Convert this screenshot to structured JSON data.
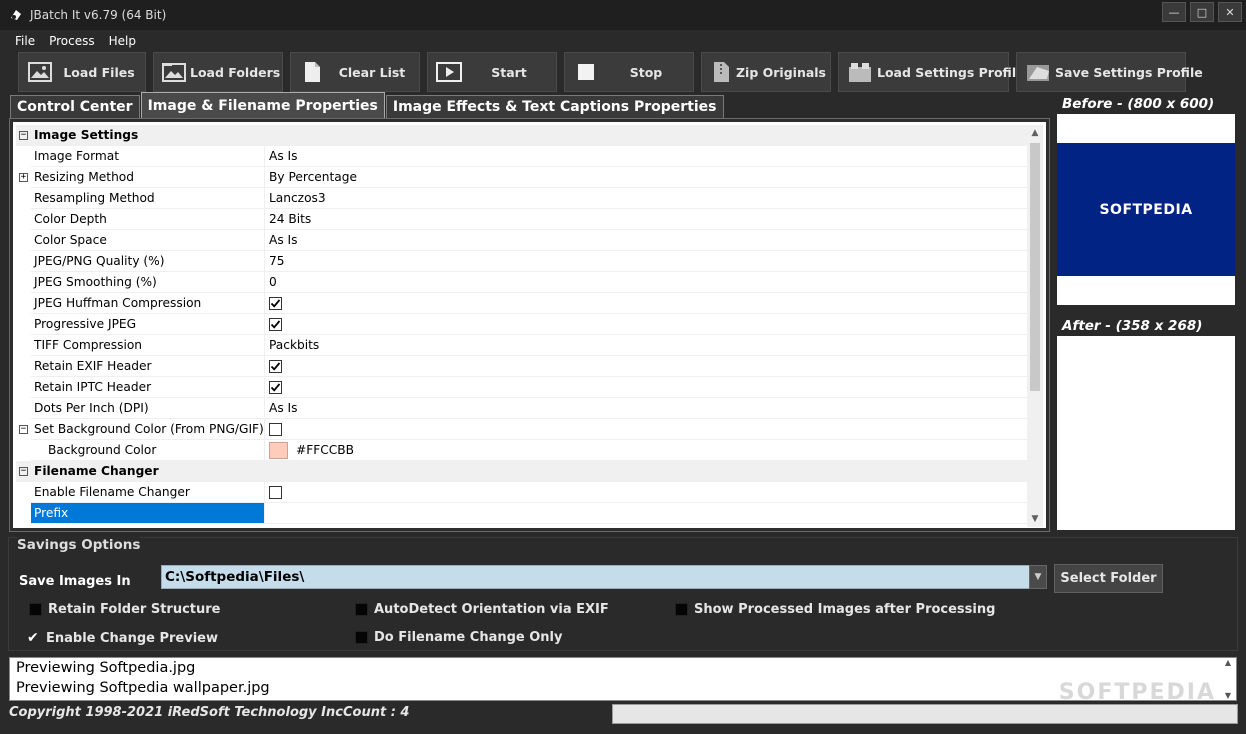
{
  "window": {
    "title": "JBatch It v6.79 (64 Bit)",
    "controls": [
      "—",
      "□",
      "✕"
    ]
  },
  "menu": [
    "File",
    "Process",
    "Help"
  ],
  "toolbar": [
    {
      "label": "Load Files",
      "icon": "image-icon",
      "width": 128
    },
    {
      "label": "Load Folders",
      "icon": "folder-image-icon",
      "width": 130
    },
    {
      "label": "Clear List",
      "icon": "document-icon",
      "width": 130
    },
    {
      "label": "Start",
      "icon": "play-icon",
      "width": 130
    },
    {
      "label": "Stop",
      "icon": "stop-icon",
      "width": 130
    },
    {
      "label": "Zip Originals",
      "icon": "zip-icon",
      "width": 130
    },
    {
      "label": "Load Settings Profile",
      "icon": "load-profile-icon",
      "width": 171
    },
    {
      "label": "Save Settings Profile",
      "icon": "save-profile-icon",
      "width": 170
    }
  ],
  "tabs": [
    {
      "label": "Control Center",
      "active": false
    },
    {
      "label": "Image & Filename Properties",
      "active": true
    },
    {
      "label": "Image Effects & Text Captions Properties",
      "active": false
    }
  ],
  "properties": [
    {
      "type": "category",
      "name": "Image Settings",
      "expander": "−"
    },
    {
      "name": "Image Format",
      "value": "As Is"
    },
    {
      "name": "Resizing Method",
      "value": "By Percentage",
      "expander": "+"
    },
    {
      "name": "Resampling Method",
      "value": "Lanczos3"
    },
    {
      "name": "Color Depth",
      "value": "24 Bits"
    },
    {
      "name": "Color Space",
      "value": "As Is"
    },
    {
      "name": "JPEG/PNG Quality (%)",
      "value": "75"
    },
    {
      "name": "JPEG Smoothing (%)",
      "value": "0"
    },
    {
      "name": "JPEG Huffman Compression",
      "check": true
    },
    {
      "name": "Progressive JPEG",
      "check": true
    },
    {
      "name": "TIFF Compression",
      "value": "Packbits"
    },
    {
      "name": "Retain EXIF Header",
      "check": true
    },
    {
      "name": "Retain IPTC Header",
      "check": true
    },
    {
      "name": "Dots Per Inch (DPI)",
      "value": "As Is"
    },
    {
      "name": "Set Background Color (From PNG/GIF)",
      "check": false,
      "expander": "−"
    },
    {
      "name": "Background Color",
      "value": "#FFCCBB",
      "swatch": "#ffccbb",
      "indent": true
    },
    {
      "type": "category",
      "name": "Filename Changer",
      "expander": "−"
    },
    {
      "name": "Enable Filename Changer",
      "check": false
    },
    {
      "name": "Prefix",
      "value": "",
      "selected": true
    }
  ],
  "preview": {
    "before_label": "Before - (800 x 600)",
    "before_image_text": "SOFTPEDIA",
    "after_label": "After - (358 x 268)"
  },
  "savings": {
    "title": "Savings Options",
    "save_in_label": "Save Images In",
    "path": "C:\\Softpedia\\Files\\",
    "select_folder": "Select Folder",
    "options": [
      {
        "label": "Retain Folder Structure",
        "checked": false
      },
      {
        "label": "AutoDetect Orientation via EXIF",
        "checked": false
      },
      {
        "label": "Show Processed Images after Processing",
        "checked": false
      },
      {
        "label": "Enable Change Preview",
        "checked": true
      },
      {
        "label": "Do Filename Change Only",
        "checked": false
      }
    ]
  },
  "log": [
    "Previewing Softpedia.jpg",
    "Previewing Softpedia wallpaper.jpg"
  ],
  "watermark": "SOFTPEDIA",
  "status": "Copyright 1998-2021 iRedSoft Technology IncCount : 4"
}
